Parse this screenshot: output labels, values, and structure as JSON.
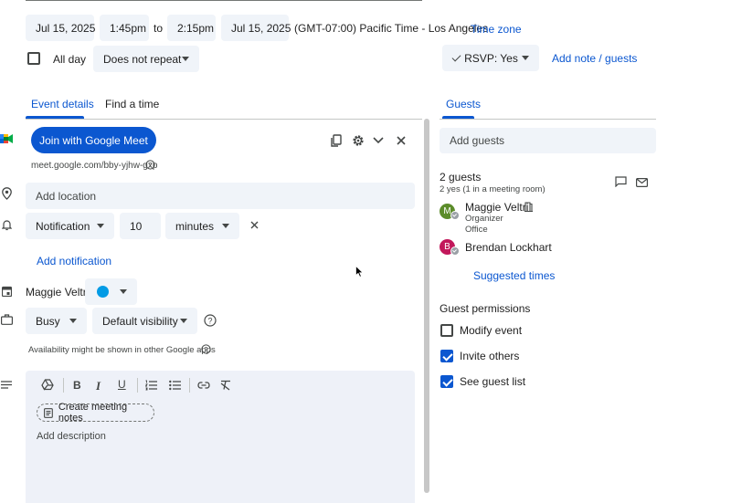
{
  "datetime": {
    "start_date": "Jul 15, 2025",
    "start_time": "1:45pm",
    "to_label": "to",
    "end_time": "2:15pm",
    "end_date": "Jul 15, 2025",
    "timezone_text": "(GMT-07:00) Pacific Time - Los Angeles",
    "timezone_link": "Time zone"
  },
  "options": {
    "all_day_label": "All day",
    "repeat_value": "Does not repeat",
    "rsvp_label": "RSVP: Yes",
    "add_note_label": "Add note / guests"
  },
  "tabs": [
    {
      "label": "Event details",
      "active": true
    },
    {
      "label": "Find a time",
      "active": false
    }
  ],
  "meet": {
    "join_label": "Join with Google Meet",
    "link": "meet.google.com/bby-yjhw-gxp"
  },
  "location": {
    "placeholder": "Add location"
  },
  "notification": {
    "type": "Notification",
    "amount": "10",
    "unit": "minutes",
    "add_label": "Add notification"
  },
  "calendar": {
    "owner": "Maggie Veltri",
    "color": "#039be5"
  },
  "status": {
    "busy": "Busy",
    "visibility": "Default visibility",
    "availability_note": "Availability might be shown in other Google apps"
  },
  "description": {
    "meeting_notes_label": "Create meeting notes",
    "placeholder": "Add description"
  },
  "guests_panel": {
    "tab_label": "Guests",
    "add_placeholder": "Add guests",
    "count_label": "2 guests",
    "summary": "2 yes (1 in a meeting room)",
    "guests": [
      {
        "initial": "M",
        "name": "Maggie Veltri",
        "role": "Organizer",
        "sub": "Office",
        "avatar_color": "#5b8c2a"
      },
      {
        "initial": "B",
        "name": "Brendan Lockhart",
        "role": "",
        "sub": "",
        "avatar_color": "#c2185b"
      }
    ],
    "suggested_times": "Suggested times",
    "permissions_title": "Guest permissions",
    "permissions": [
      {
        "label": "Modify event",
        "checked": false
      },
      {
        "label": "Invite others",
        "checked": true
      },
      {
        "label": "See guest list",
        "checked": true
      }
    ]
  }
}
